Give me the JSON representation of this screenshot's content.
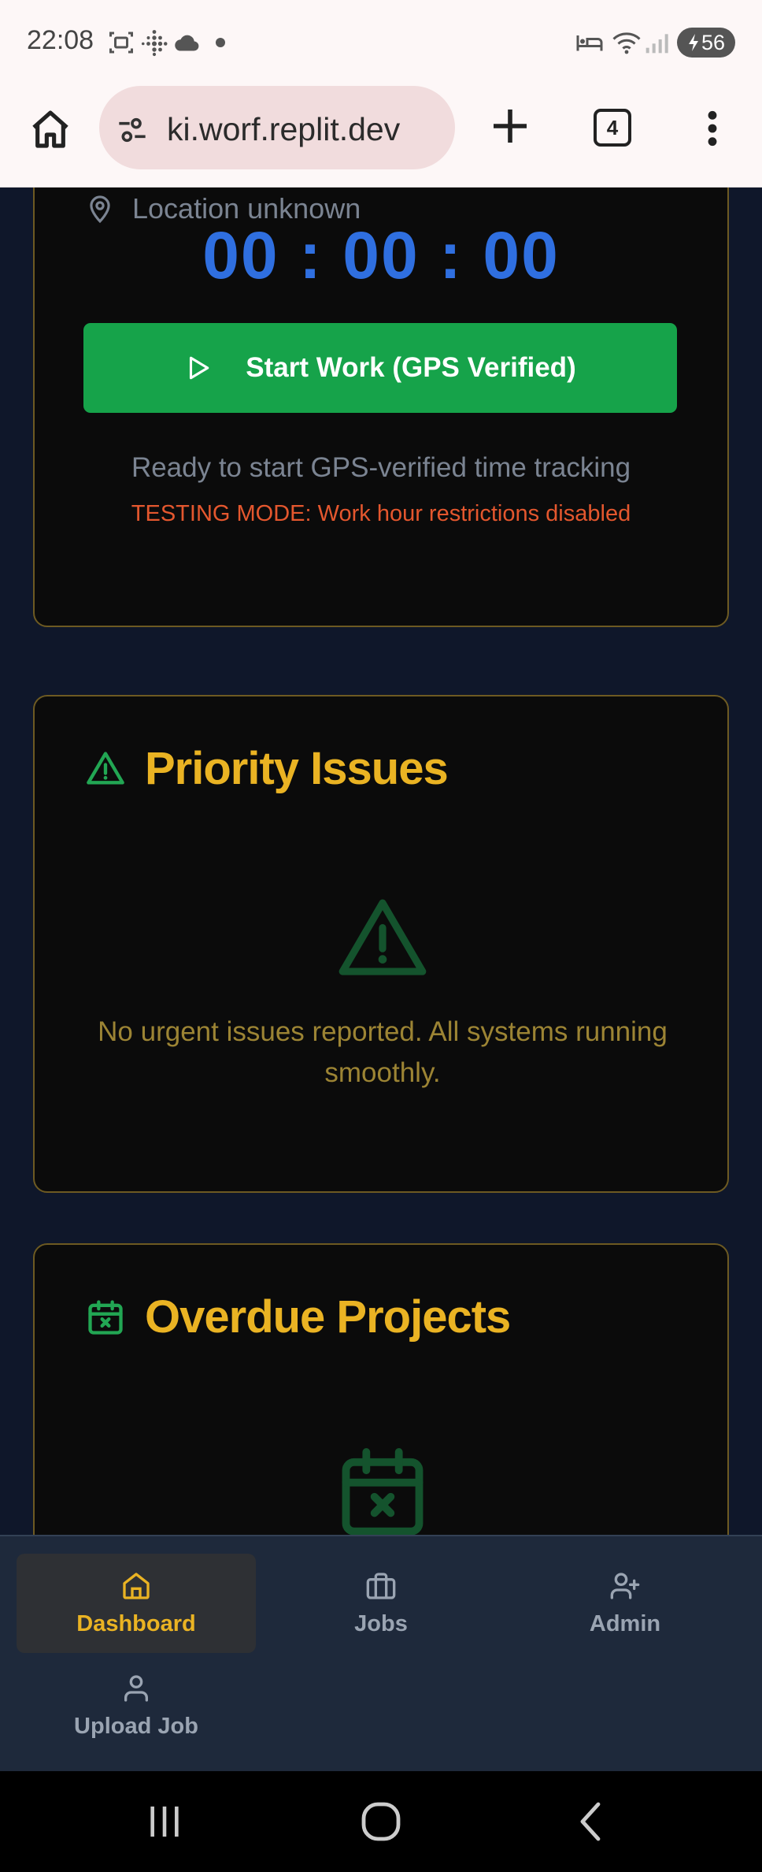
{
  "status_bar": {
    "time": "22:08",
    "battery": "56",
    "icons": [
      "screenshot-icon",
      "fitbit-icon",
      "cloud-icon",
      "dot-icon",
      "bed-icon",
      "wifi-icon",
      "signal-icon",
      "battery-charging-icon"
    ]
  },
  "browser": {
    "url": "ki.worf.replit.dev",
    "tab_count": "4",
    "icons": [
      "home-icon",
      "tune-icon",
      "plus-icon",
      "more-vert-icon"
    ]
  },
  "timer_card": {
    "location": "Location unknown",
    "timer": "00 : 00 : 00",
    "start_button": "Start Work (GPS Verified)",
    "ready_text": "Ready to start GPS-verified time tracking",
    "testing_text": "TESTING MODE: Work hour restrictions disabled"
  },
  "priority_card": {
    "title": "Priority Issues",
    "empty_text": "No urgent issues reported. All systems running smoothly."
  },
  "overdue_card": {
    "title": "Overdue Projects"
  },
  "bottom_nav": {
    "items": [
      {
        "label": "Dashboard",
        "icon": "home-icon",
        "active": true
      },
      {
        "label": "Jobs",
        "icon": "briefcase-icon",
        "active": false
      },
      {
        "label": "Admin",
        "icon": "user-plus-icon",
        "active": false
      },
      {
        "label": "Upload Job",
        "icon": "user-icon",
        "active": false
      }
    ]
  },
  "colors": {
    "page_bg": "#0f172a",
    "card_bg": "#0b0b0b",
    "card_border": "#6d5a22",
    "accent_yellow": "#eab323",
    "accent_green": "#16a34a",
    "timer_blue": "#2f6fe0",
    "warning_orange": "#e4572e"
  }
}
